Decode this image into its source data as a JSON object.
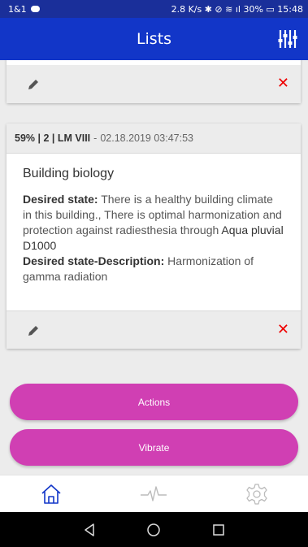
{
  "statusbar": {
    "left_text": "1&1",
    "right_text": "2.8 K/s ✱ ⊘ ≋ ıl 30% ▭ 15:48"
  },
  "appbar": {
    "title": "Lists"
  },
  "cards": {
    "main": {
      "header_score": "59% | 2 | LM VIII",
      "header_sep": "-",
      "header_date": "02.18.2019 03:47:53",
      "title": "Building biology",
      "desired_state_label": "Desired state:",
      "desired_state_text": "There is a healthy building climate in this building., There is optimal harmonization and protection against radiesthesia through",
      "desired_state_product": "Aqua pluvial D1000",
      "desired_desc_label": "Desired state-Description:",
      "desired_desc_text": "Harmonization of gamma radiation"
    },
    "delete_glyph": "✕"
  },
  "buttons": {
    "actions_label": "Actions",
    "vibrate_label": "Vibrate"
  },
  "tabs": [
    "home-icon",
    "pulse-icon",
    "settings-icon"
  ],
  "colors": {
    "statusbar": "#1a2f9a",
    "appbar": "#1236c8",
    "pill": "#d03fb3",
    "delete": "#e00000",
    "tab_icon": "#1236c8",
    "tab_icon_inactive": "#bbbbbb"
  }
}
